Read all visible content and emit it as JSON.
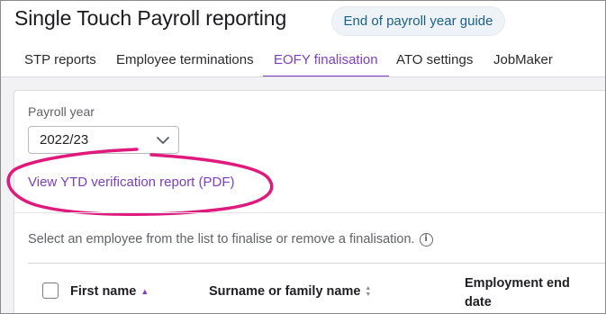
{
  "header": {
    "title": "Single Touch Payroll reporting",
    "guide_button": "End of payroll year guide"
  },
  "tabs": [
    {
      "label": "STP reports",
      "active": false
    },
    {
      "label": "Employee terminations",
      "active": false
    },
    {
      "label": "EOFY finalisation",
      "active": true
    },
    {
      "label": "ATO settings",
      "active": false
    },
    {
      "label": "JobMaker",
      "active": false
    }
  ],
  "payroll_year": {
    "label": "Payroll year",
    "selected": "2022/23"
  },
  "report_link": "View YTD verification report (PDF)",
  "hint": "Select an employee from the list to finalise or remove a finalisation.",
  "table": {
    "columns": [
      {
        "label": "First name",
        "sort": "ascending"
      },
      {
        "label": "Surname or family name",
        "sort": "none"
      },
      {
        "label": "Employment end date",
        "sort": "none"
      }
    ]
  },
  "colors": {
    "accent": "#7b3fbf",
    "annotation": "#e0197d",
    "guide_text": "#1a5f86"
  }
}
